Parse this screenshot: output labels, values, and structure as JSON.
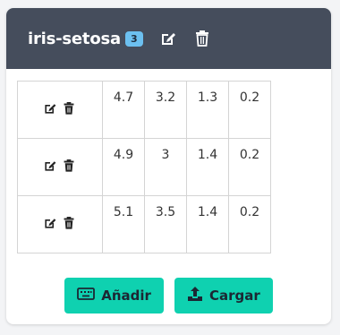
{
  "header": {
    "title": "iris-setosa",
    "badge": "3",
    "edit_icon": "edit-icon",
    "delete_icon": "trash-icon"
  },
  "rows": [
    {
      "values": [
        "4.7",
        "3.2",
        "1.3",
        "0.2"
      ]
    },
    {
      "values": [
        "4.9",
        "3",
        "1.4",
        "0.2"
      ]
    },
    {
      "values": [
        "5.1",
        "3.5",
        "1.4",
        "0.2"
      ]
    }
  ],
  "footer": {
    "add_label": "Añadir",
    "add_icon": "keyboard-icon",
    "upload_label": "Cargar",
    "upload_icon": "upload-icon"
  },
  "colors": {
    "header_bg": "#454d5c",
    "badge_bg": "#6cc0f0",
    "button_bg": "#0fd1b0"
  }
}
